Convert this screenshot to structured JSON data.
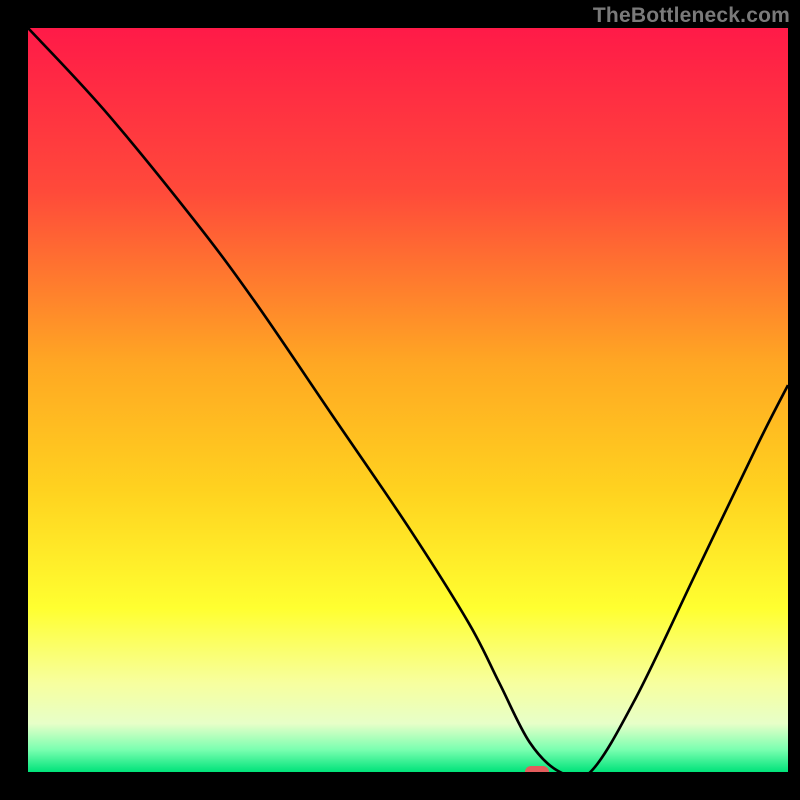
{
  "watermark": "TheBottleneck.com",
  "colors": {
    "background": "#000000",
    "gradient_stops": [
      {
        "offset": 0.0,
        "color": "#ff1a48"
      },
      {
        "offset": 0.22,
        "color": "#ff4a3a"
      },
      {
        "offset": 0.45,
        "color": "#ffa723"
      },
      {
        "offset": 0.62,
        "color": "#ffd21f"
      },
      {
        "offset": 0.78,
        "color": "#ffff30"
      },
      {
        "offset": 0.88,
        "color": "#f7ff9e"
      },
      {
        "offset": 0.935,
        "color": "#e7ffc8"
      },
      {
        "offset": 0.97,
        "color": "#7affb0"
      },
      {
        "offset": 1.0,
        "color": "#00e37a"
      }
    ],
    "curve_stroke": "#000000",
    "marker_fill": "#e35c5c",
    "watermark_color": "#7a7a7a"
  },
  "chart_data": {
    "type": "line",
    "title": "",
    "xlabel": "",
    "ylabel": "",
    "xlim": [
      0,
      100
    ],
    "ylim": [
      0,
      100
    ],
    "grid": false,
    "legend": null,
    "series": [
      {
        "name": "curve",
        "x": [
          0,
          10,
          22,
          30,
          40,
          50,
          58,
          62,
          66,
          70,
          74,
          80,
          88,
          96,
          100
        ],
        "y": [
          100,
          89,
          74,
          63,
          48,
          33,
          20,
          12,
          4,
          0,
          0,
          10,
          27,
          44,
          52
        ]
      }
    ],
    "marker": {
      "x": 67,
      "y": 0
    }
  }
}
